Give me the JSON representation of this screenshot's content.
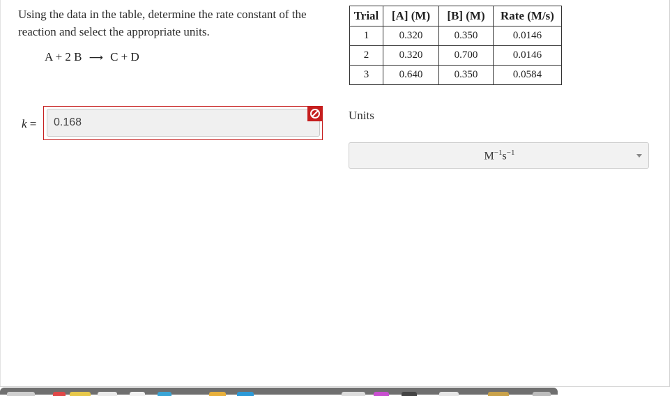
{
  "question": {
    "text": "Using the data in the table, determine the rate constant of the reaction and select the appropriate units.",
    "equation": {
      "lhs": "A + 2 B",
      "rhs": "C + D"
    }
  },
  "table": {
    "headers": [
      "Trial",
      "[A] (M)",
      "[B] (M)",
      "Rate (M/s)"
    ],
    "rows": [
      [
        "1",
        "0.320",
        "0.350",
        "0.0146"
      ],
      [
        "2",
        "0.320",
        "0.700",
        "0.0146"
      ],
      [
        "3",
        "0.640",
        "0.350",
        "0.0584"
      ]
    ]
  },
  "answer": {
    "label_var": "k",
    "label_eq": " =",
    "value": "0.168",
    "status": "incorrect",
    "error_color": "#c61e1e"
  },
  "units": {
    "label": "Units",
    "selected": {
      "base1": "M",
      "exp1": "−1",
      "base2": "s",
      "exp2": "−1"
    }
  }
}
